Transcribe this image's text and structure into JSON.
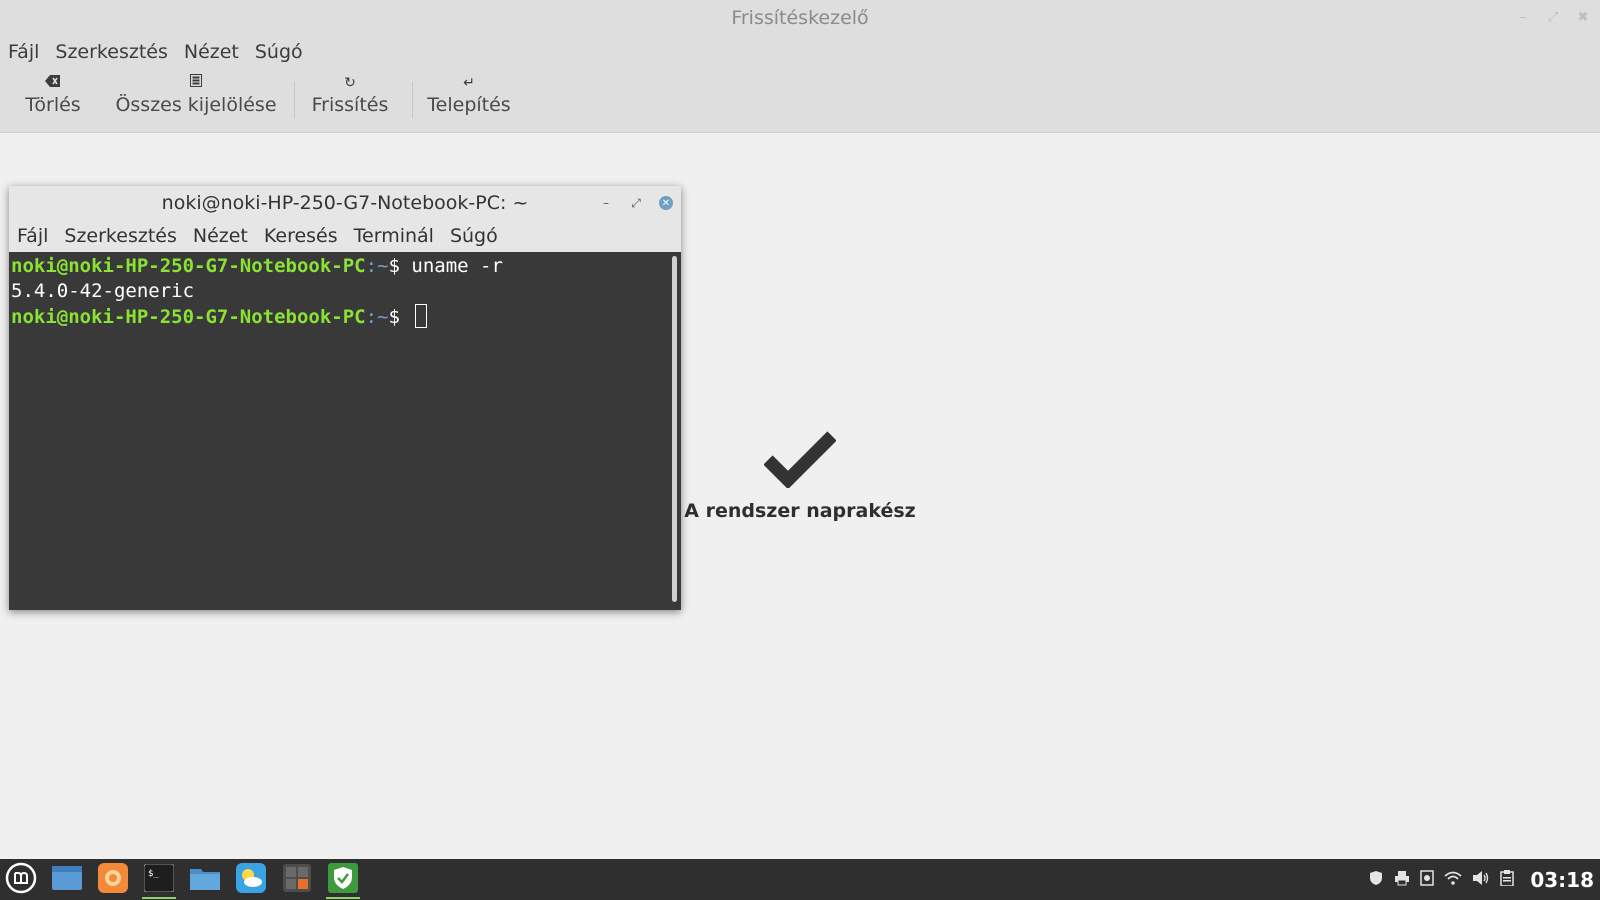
{
  "main_window": {
    "title": "Frissítéskezelő",
    "menu": [
      "Fájl",
      "Szerkesztés",
      "Nézet",
      "Súgó"
    ],
    "toolbar": {
      "clear_label": "Törlés",
      "select_all_label": "Összes kijelölése",
      "refresh_label": "Frissítés",
      "install_label": "Telepítés"
    },
    "status_text": "A rendszer naprakész"
  },
  "terminal": {
    "title": "noki@noki-HP-250-G7-Notebook-PC: ~",
    "menu": [
      "Fájl",
      "Szerkesztés",
      "Nézet",
      "Keresés",
      "Terminál",
      "Súgó"
    ],
    "prompt_user": "noki@noki-HP-250-G7-Notebook-PC",
    "prompt_path": ":~",
    "prompt_symbol": "$ ",
    "command": "uname -r",
    "output": "5.4.0-42-generic"
  },
  "taskbar": {
    "clock": "03:18",
    "launchers": [
      "menu-icon",
      "show-desktop-icon",
      "firefox-icon",
      "terminal-icon",
      "files-icon",
      "weather-icon",
      "calculator-icon",
      "update-manager-icon"
    ],
    "tray": [
      "shield-icon",
      "printer-icon",
      "screenshot-icon",
      "wifi-icon",
      "volume-icon",
      "clipboard-icon"
    ]
  },
  "colors": {
    "prompt_green": "#8ae234",
    "prompt_blue": "#729fcf",
    "terminal_bg": "#393939",
    "taskbar_bg": "#2f2f2f"
  }
}
